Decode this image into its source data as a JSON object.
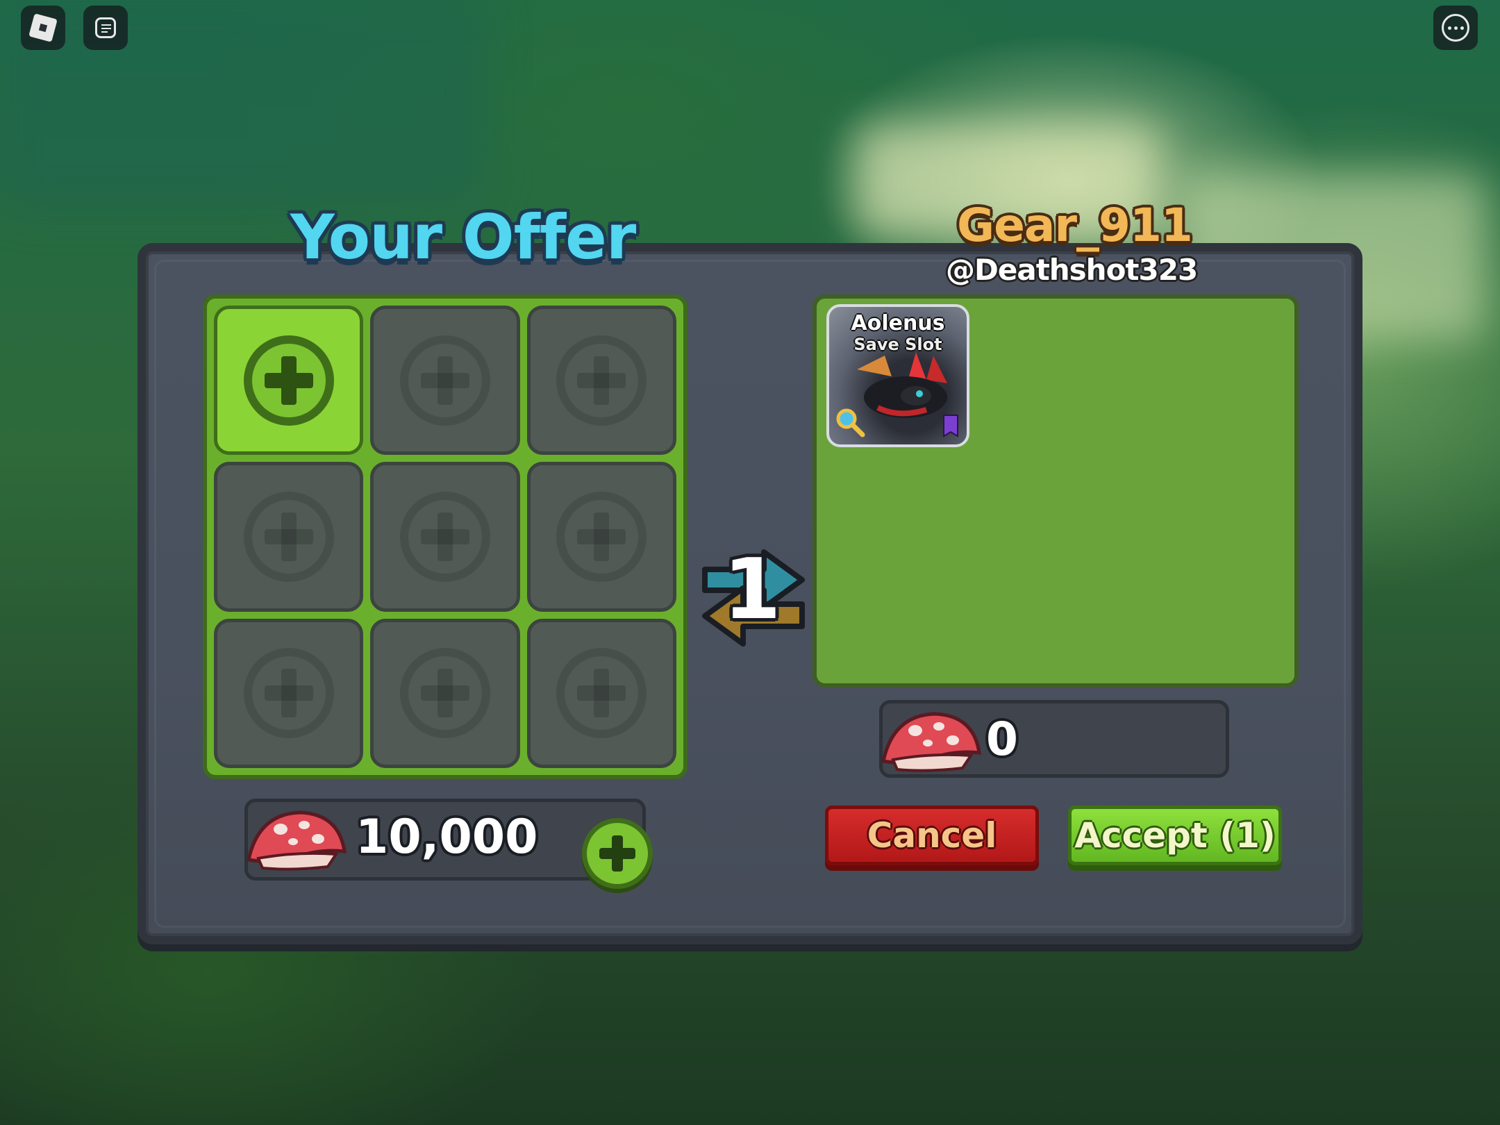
{
  "topbar": {
    "roblox_icon": "roblox-logo-icon",
    "chat_icon": "chat-icon",
    "menu_icon": "more-options-icon"
  },
  "trade": {
    "your_offer_title": "Your Offer",
    "partner_display_name": "Gear_911",
    "partner_username": "@Deathshot323",
    "offer_slots_total": 9,
    "their_items": [
      {
        "name": "Aolenus",
        "subtitle": "Save Slot"
      }
    ],
    "swap_count": "1",
    "your_currency": "10,000",
    "their_currency": "0",
    "cancel_label": "Cancel",
    "accept_label": "Accept (1)"
  },
  "colors": {
    "your_offer_title": "#53d6f0",
    "partner_name": "#f2b857",
    "cancel": "#c82222",
    "accept": "#78cc2e",
    "slot_active": "#8bd436"
  }
}
